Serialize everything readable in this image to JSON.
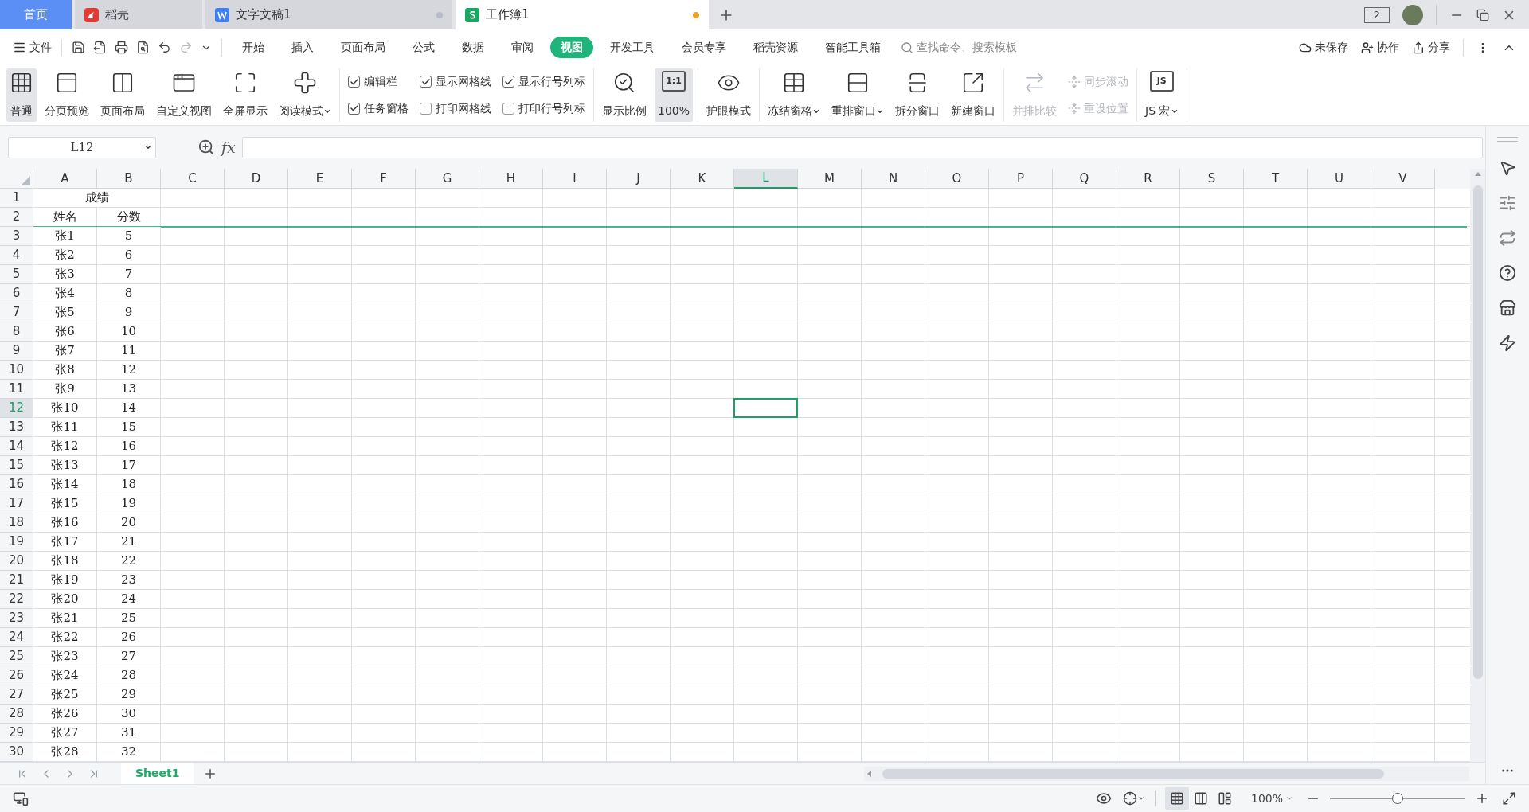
{
  "tabs": [
    {
      "label": "首页",
      "kind": "home",
      "selected": false
    },
    {
      "label": "稻壳",
      "kind": "docer",
      "selected": false
    },
    {
      "label": "文字文稿1",
      "kind": "writer",
      "selected": false,
      "modified": false
    },
    {
      "label": "工作簿1",
      "kind": "sheet",
      "selected": true,
      "modified": true
    }
  ],
  "device_badge": "2",
  "menu": {
    "file": "文件",
    "items": [
      {
        "label": "开始",
        "selected": false
      },
      {
        "label": "插入",
        "selected": false
      },
      {
        "label": "页面布局",
        "selected": false
      },
      {
        "label": "公式",
        "selected": false
      },
      {
        "label": "数据",
        "selected": false
      },
      {
        "label": "审阅",
        "selected": false
      },
      {
        "label": "视图",
        "selected": true
      },
      {
        "label": "开发工具",
        "selected": false
      },
      {
        "label": "会员专享",
        "selected": false
      },
      {
        "label": "稻壳资源",
        "selected": false
      },
      {
        "label": "智能工具箱",
        "selected": false
      }
    ],
    "search": {
      "placeholder": "查找命令、搜索模板"
    },
    "actions": [
      "未保存",
      "协作",
      "分享"
    ]
  },
  "ribbon": [
    {
      "items": [
        {
          "kind": "big",
          "label": "普通",
          "selected": true
        },
        {
          "kind": "big",
          "label": "分页预览",
          "selected": false
        },
        {
          "kind": "big",
          "label": "页面布局",
          "selected": false
        },
        {
          "kind": "big",
          "label": "自定义视图",
          "selected": false
        },
        {
          "kind": "big",
          "label": "全屏显示",
          "selected": false
        },
        {
          "kind": "big",
          "label": "阅读模式",
          "selected": false,
          "dropdown": true
        }
      ]
    },
    {
      "items": [
        {
          "kind": "checks",
          "checks": [
            {
              "label": "编辑栏",
              "checked": true
            },
            {
              "label": "任务窗格",
              "checked": true
            }
          ]
        },
        {
          "kind": "checks",
          "checks": [
            {
              "label": "显示网格线",
              "checked": true
            },
            {
              "label": "打印网格线",
              "checked": false
            }
          ]
        },
        {
          "kind": "checks",
          "checks": [
            {
              "label": "显示行号列标",
              "checked": true
            },
            {
              "label": "打印行号列标",
              "checked": false
            }
          ]
        }
      ]
    },
    {
      "items": [
        {
          "kind": "big",
          "label": "显示比例",
          "selected": false
        },
        {
          "kind": "big",
          "label": "100%",
          "selected": true,
          "icon_text": "1:1"
        }
      ]
    },
    {
      "items": [
        {
          "kind": "big",
          "label": "护眼模式",
          "selected": false
        }
      ]
    },
    {
      "items": [
        {
          "kind": "big",
          "label": "冻结窗格",
          "selected": false,
          "dropdown": true
        },
        {
          "kind": "big",
          "label": "重排窗口",
          "selected": false,
          "dropdown": true
        },
        {
          "kind": "big",
          "label": "拆分窗口",
          "selected": false
        },
        {
          "kind": "big",
          "label": "新建窗口",
          "selected": false
        }
      ]
    },
    {
      "items": [
        {
          "kind": "big",
          "label": "并排比较",
          "selected": false,
          "disabled": true
        },
        {
          "kind": "small",
          "rows": [
            {
              "label": "同步滚动",
              "disabled": true
            },
            {
              "label": "重设位置",
              "disabled": true
            }
          ]
        }
      ]
    },
    {
      "items": [
        {
          "kind": "big",
          "label": "JS 宏",
          "selected": false,
          "dropdown": true,
          "icon_text": "JS"
        }
      ]
    }
  ],
  "formula_bar": {
    "cell_ref": "L12",
    "fx": "fx"
  },
  "sheet": {
    "columns": [
      {
        "label": "A",
        "selected": false
      },
      {
        "label": "B",
        "selected": false
      },
      {
        "label": "C",
        "selected": false
      },
      {
        "label": "D",
        "selected": false
      },
      {
        "label": "E",
        "selected": false
      },
      {
        "label": "F",
        "selected": false
      },
      {
        "label": "G",
        "selected": false
      },
      {
        "label": "H",
        "selected": false
      },
      {
        "label": "I",
        "selected": false
      },
      {
        "label": "J",
        "selected": false
      },
      {
        "label": "K",
        "selected": false
      },
      {
        "label": "L",
        "selected": true
      },
      {
        "label": "M",
        "selected": false
      },
      {
        "label": "N",
        "selected": false
      },
      {
        "label": "O",
        "selected": false
      },
      {
        "label": "P",
        "selected": false
      },
      {
        "label": "Q",
        "selected": false
      },
      {
        "label": "R",
        "selected": false
      },
      {
        "label": "S",
        "selected": false
      },
      {
        "label": "T",
        "selected": false
      },
      {
        "label": "U",
        "selected": false
      },
      {
        "label": "V",
        "selected": false
      }
    ],
    "rows": [
      {
        "number": "1",
        "selected": false,
        "cells": [
          {
            "text": "成绩",
            "kind": "merged"
          }
        ]
      },
      {
        "number": "2",
        "selected": false,
        "freeze_below": true,
        "cells": [
          {
            "text": "姓名",
            "kind": "single"
          },
          {
            "text": "分数",
            "kind": "single"
          }
        ]
      },
      {
        "number": "3",
        "selected": false,
        "cells": [
          {
            "text": "张1",
            "kind": "single"
          },
          {
            "text": "5",
            "kind": "single"
          }
        ]
      },
      {
        "number": "4",
        "selected": false,
        "cells": [
          {
            "text": "张2",
            "kind": "single"
          },
          {
            "text": "6",
            "kind": "single"
          }
        ]
      },
      {
        "number": "5",
        "selected": false,
        "cells": [
          {
            "text": "张3",
            "kind": "single"
          },
          {
            "text": "7",
            "kind": "single"
          }
        ]
      },
      {
        "number": "6",
        "selected": false,
        "cells": [
          {
            "text": "张4",
            "kind": "single"
          },
          {
            "text": "8",
            "kind": "single"
          }
        ]
      },
      {
        "number": "7",
        "selected": false,
        "cells": [
          {
            "text": "张5",
            "kind": "single"
          },
          {
            "text": "9",
            "kind": "single"
          }
        ]
      },
      {
        "number": "8",
        "selected": false,
        "cells": [
          {
            "text": "张6",
            "kind": "single"
          },
          {
            "text": "10",
            "kind": "single"
          }
        ]
      },
      {
        "number": "9",
        "selected": false,
        "cells": [
          {
            "text": "张7",
            "kind": "single"
          },
          {
            "text": "11",
            "kind": "single"
          }
        ]
      },
      {
        "number": "10",
        "selected": false,
        "cells": [
          {
            "text": "张8",
            "kind": "single"
          },
          {
            "text": "12",
            "kind": "single"
          }
        ]
      },
      {
        "number": "11",
        "selected": false,
        "cells": [
          {
            "text": "张9",
            "kind": "single"
          },
          {
            "text": "13",
            "kind": "single"
          }
        ]
      },
      {
        "number": "12",
        "selected": true,
        "cells": [
          {
            "text": "张10",
            "kind": "single"
          },
          {
            "text": "14",
            "kind": "single"
          }
        ]
      },
      {
        "number": "13",
        "selected": false,
        "cells": [
          {
            "text": "张11",
            "kind": "single"
          },
          {
            "text": "15",
            "kind": "single"
          }
        ]
      },
      {
        "number": "14",
        "selected": false,
        "cells": [
          {
            "text": "张12",
            "kind": "single"
          },
          {
            "text": "16",
            "kind": "single"
          }
        ]
      },
      {
        "number": "15",
        "selected": false,
        "cells": [
          {
            "text": "张13",
            "kind": "single"
          },
          {
            "text": "17",
            "kind": "single"
          }
        ]
      },
      {
        "number": "16",
        "selected": false,
        "cells": [
          {
            "text": "张14",
            "kind": "single"
          },
          {
            "text": "18",
            "kind": "single"
          }
        ]
      },
      {
        "number": "17",
        "selected": false,
        "cells": [
          {
            "text": "张15",
            "kind": "single"
          },
          {
            "text": "19",
            "kind": "single"
          }
        ]
      },
      {
        "number": "18",
        "selected": false,
        "cells": [
          {
            "text": "张16",
            "kind": "single"
          },
          {
            "text": "20",
            "kind": "single"
          }
        ]
      },
      {
        "number": "19",
        "selected": false,
        "cells": [
          {
            "text": "张17",
            "kind": "single"
          },
          {
            "text": "21",
            "kind": "single"
          }
        ]
      },
      {
        "number": "20",
        "selected": false,
        "cells": [
          {
            "text": "张18",
            "kind": "single"
          },
          {
            "text": "22",
            "kind": "single"
          }
        ]
      },
      {
        "number": "21",
        "selected": false,
        "cells": [
          {
            "text": "张19",
            "kind": "single"
          },
          {
            "text": "23",
            "kind": "single"
          }
        ]
      },
      {
        "number": "22",
        "selected": false,
        "cells": [
          {
            "text": "张20",
            "kind": "single"
          },
          {
            "text": "24",
            "kind": "single"
          }
        ]
      },
      {
        "number": "23",
        "selected": false,
        "cells": [
          {
            "text": "张21",
            "kind": "single"
          },
          {
            "text": "25",
            "kind": "single"
          }
        ]
      },
      {
        "number": "24",
        "selected": false,
        "cells": [
          {
            "text": "张22",
            "kind": "single"
          },
          {
            "text": "26",
            "kind": "single"
          }
        ]
      },
      {
        "number": "25",
        "selected": false,
        "cells": [
          {
            "text": "张23",
            "kind": "single"
          },
          {
            "text": "27",
            "kind": "single"
          }
        ]
      },
      {
        "number": "26",
        "selected": false,
        "cells": [
          {
            "text": "张24",
            "kind": "single"
          },
          {
            "text": "28",
            "kind": "single"
          }
        ]
      },
      {
        "number": "27",
        "selected": false,
        "cells": [
          {
            "text": "张25",
            "kind": "single"
          },
          {
            "text": "29",
            "kind": "single"
          }
        ]
      },
      {
        "number": "28",
        "selected": false,
        "cells": [
          {
            "text": "张26",
            "kind": "single"
          },
          {
            "text": "30",
            "kind": "single"
          }
        ]
      },
      {
        "number": "29",
        "selected": false,
        "cells": [
          {
            "text": "张27",
            "kind": "single"
          },
          {
            "text": "31",
            "kind": "single"
          }
        ]
      },
      {
        "number": "30",
        "selected": false,
        "cells": [
          {
            "text": "张28",
            "kind": "single"
          },
          {
            "text": "32",
            "kind": "single"
          }
        ]
      }
    ]
  },
  "sheet_tabs": [
    {
      "label": "Sheet1",
      "selected": true
    }
  ],
  "status_bar": {
    "view_modes": [
      {
        "kind": "normal",
        "selected": true
      },
      {
        "kind": "page_break",
        "selected": false
      },
      {
        "kind": "page_layout",
        "selected": false
      }
    ],
    "zoom": "100%",
    "zoom_slider": {
      "level": 0.5
    }
  }
}
